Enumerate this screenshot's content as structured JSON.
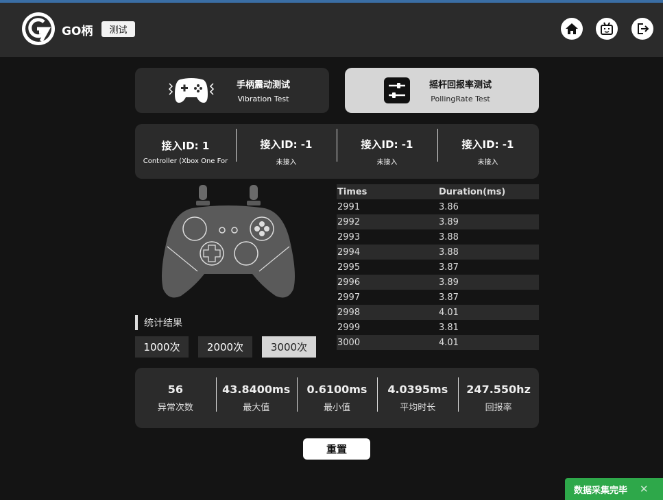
{
  "app": {
    "name": "GO柄",
    "tag": "测试"
  },
  "toolbar": {
    "icons": [
      "home-icon",
      "robot-icon",
      "exit-icon"
    ]
  },
  "modes": [
    {
      "title": "手柄震动测试",
      "subtitle": "Vibration Test",
      "icon": "gamepad-vibrate-icon",
      "active": false
    },
    {
      "title": "摇杆回报率测试",
      "subtitle": "PollingRate Test",
      "icon": "sliders-icon",
      "active": true
    }
  ],
  "controllers": [
    {
      "label": "接入ID: 1",
      "status": "Controller (Xbox One For"
    },
    {
      "label": "接入ID: -1",
      "status": "未接入"
    },
    {
      "label": "接入ID: -1",
      "status": "未接入"
    },
    {
      "label": "接入ID: -1",
      "status": "未接入"
    }
  ],
  "stats": {
    "title": "统计结果",
    "counts": [
      "1000次",
      "2000次",
      "3000次"
    ],
    "selected": "3000次"
  },
  "table": {
    "headers": [
      "Times",
      "Duration(ms)"
    ],
    "rows": [
      [
        "2991",
        "3.86"
      ],
      [
        "2992",
        "3.89"
      ],
      [
        "2993",
        "3.88"
      ],
      [
        "2994",
        "3.88"
      ],
      [
        "2995",
        "3.87"
      ],
      [
        "2996",
        "3.89"
      ],
      [
        "2997",
        "3.87"
      ],
      [
        "2998",
        "4.01"
      ],
      [
        "2999",
        "3.81"
      ],
      [
        "3000",
        "4.01"
      ]
    ]
  },
  "summary": [
    {
      "value": "56",
      "label": "异常次数"
    },
    {
      "value": "43.8400ms",
      "label": "最大值"
    },
    {
      "value": "0.6100ms",
      "label": "最小值"
    },
    {
      "value": "4.0395ms",
      "label": "平均时长"
    },
    {
      "value": "247.550hz",
      "label": "回报率"
    }
  ],
  "reset_label": "重置",
  "toast": {
    "message": "数据采集完毕",
    "close": "✕"
  },
  "colors": {
    "accent_green": "#2ea84a",
    "panel": "#2b2b2b",
    "background": "#141414"
  }
}
